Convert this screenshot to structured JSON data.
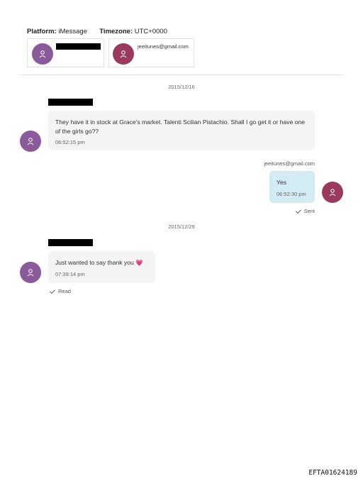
{
  "header": {
    "platform_label": "Platform:",
    "platform_value": "iMessage",
    "timezone_label": "Timezone:",
    "timezone_value": "UTC+0000"
  },
  "participants": [
    {
      "name": "",
      "redacted": true,
      "avatar_color": "#8b5a9b",
      "icon": "person-icon"
    },
    {
      "name": "jeeitunes@gmail.com",
      "redacted": false,
      "avatar_color": "#9a3a5e",
      "icon": "person-icon"
    }
  ],
  "conversation": [
    {
      "type": "date",
      "text": "2015/12/16"
    },
    {
      "type": "message",
      "direction": "incoming",
      "sender_redacted": true,
      "text": "They have it in stock at Grace's market. Talenti Scilian Pistachio. Shall I go get it or have one of the girls go??",
      "time": "06:52:15 pm"
    },
    {
      "type": "message",
      "direction": "outgoing",
      "sender": "jeeitunes@gmail.com",
      "text": "Yes",
      "time": "06:52:30 pm",
      "status": "Sent"
    },
    {
      "type": "date",
      "text": "2015/12/29"
    },
    {
      "type": "message",
      "direction": "incoming",
      "sender_redacted": true,
      "text": "Just wanted to say thank you",
      "emoji": "💗",
      "time": "07:39:14 pm",
      "status": "Read"
    }
  ],
  "footer": {
    "doc_id": "EFTA01624189"
  },
  "colors": {
    "incoming_avatar": "#8b5a9b",
    "outgoing_avatar": "#9a3a5e",
    "incoming_bubble": "#f5f3f3",
    "outgoing_bubble": "#d3ebf2"
  }
}
